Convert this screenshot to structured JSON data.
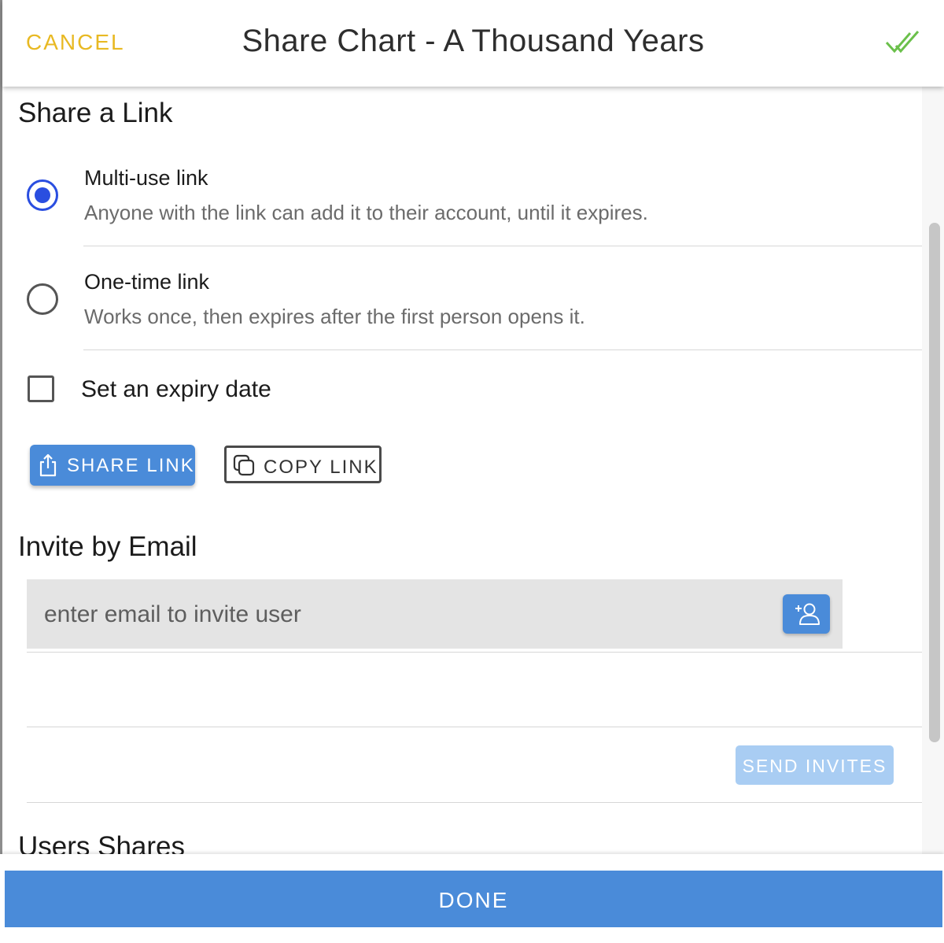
{
  "header": {
    "cancel_label": "CANCEL",
    "title": "Share Chart - A Thousand Years",
    "confirm_icon": "double-check-icon"
  },
  "share_link": {
    "title": "Share a Link",
    "options": [
      {
        "label": "Multi-use link",
        "description": "Anyone with the link can add it to their account, until it expires.",
        "selected": true
      },
      {
        "label": "One-time link",
        "description": "Works once, then expires after the first person opens it.",
        "selected": false
      }
    ],
    "expiry_label": "Set an expiry date",
    "expiry_checked": false,
    "share_button": "SHARE LINK",
    "copy_button": "COPY LINK"
  },
  "invite": {
    "title": "Invite by Email",
    "email_placeholder": "enter email to invite user",
    "email_value": "",
    "send_button": "SEND INVITES"
  },
  "users_shares": {
    "title": "Users Shares"
  },
  "footer": {
    "done_label": "DONE"
  },
  "colors": {
    "accent_blue": "#4a8bd9",
    "cancel_yellow": "#e8b923",
    "confirm_green": "#6bc04b",
    "radio_selected": "#2a4ee0",
    "send_disabled": "#a9cdf3"
  }
}
